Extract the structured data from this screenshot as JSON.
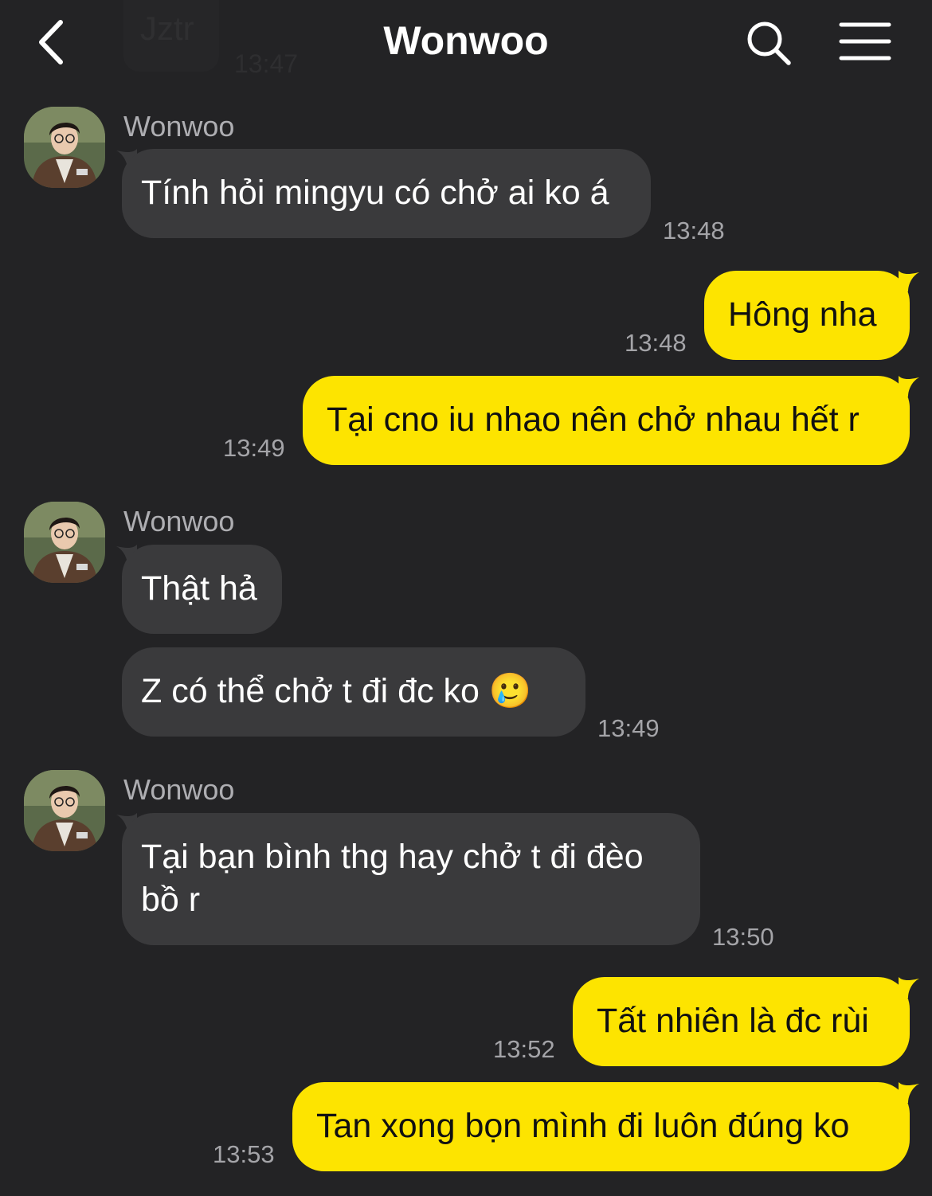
{
  "header": {
    "title": "Wonwoo"
  },
  "ghost": {
    "text": "Jztr",
    "time": "13:47"
  },
  "messages": [
    {
      "sender": "Wonwoo",
      "text": "Tính hỏi mingyu có chở ai ko á",
      "time": "13:48"
    },
    {
      "text": "Hông nha",
      "time": "13:48"
    },
    {
      "text": "Tại cno iu nhao nên chở nhau hết r",
      "time": "13:49"
    },
    {
      "sender": "Wonwoo",
      "text": "Thật hả"
    },
    {
      "text": "Z có thể chở t đi đc ko 🥲",
      "time": "13:49"
    },
    {
      "sender": "Wonwoo",
      "text_line1": "Tại bạn bình thg hay chở t đi đèo",
      "text_line2": "bồ r",
      "time": "13:50"
    },
    {
      "text": "Tất nhiên là đc rùi",
      "time": "13:52"
    },
    {
      "text": "Tan xong bọn mình đi luôn đúng ko",
      "time": "13:53"
    }
  ],
  "colors": {
    "background": "#232325",
    "received_bubble": "#3a3a3c",
    "sent_bubble": "#fde400",
    "timestamp": "#a4a4a8"
  },
  "icons": [
    "back-chevron-icon",
    "search-icon",
    "menu-icon",
    "avatar"
  ]
}
